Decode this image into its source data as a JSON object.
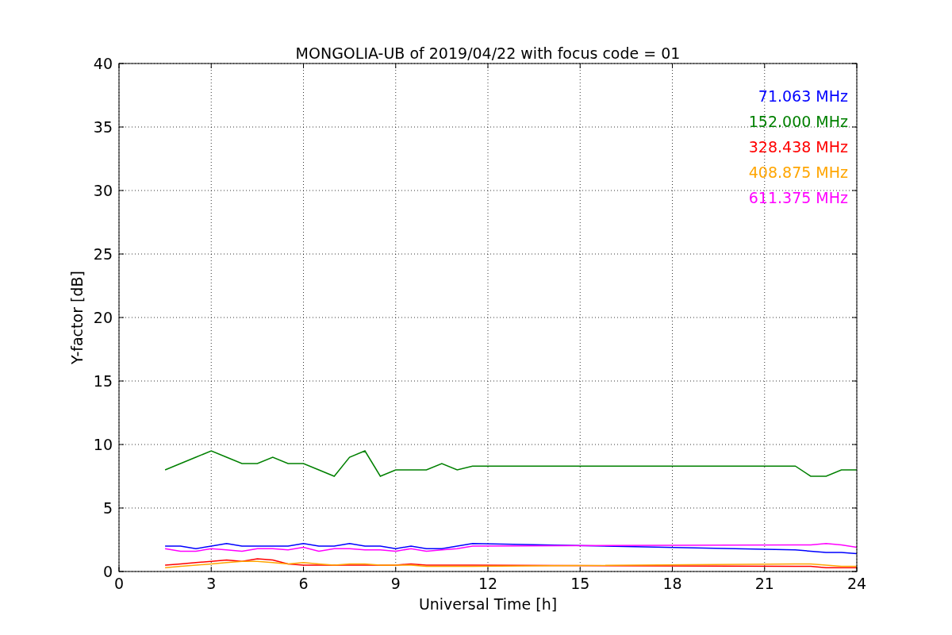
{
  "chart_data": {
    "type": "line",
    "title": "MONGOLIA-UB of 2019/04/22 with focus code = 01",
    "xlabel": "Universal Time [h]",
    "ylabel": "Y-factor [dB]",
    "x": [
      1.5,
      2,
      2.5,
      3,
      3.5,
      4,
      4.5,
      5,
      5.5,
      6,
      6.5,
      7,
      7.5,
      8,
      8.5,
      9,
      9.5,
      10,
      10.5,
      11,
      11.5,
      22,
      22.5,
      23,
      23.5,
      24
    ],
    "series": [
      {
        "name": "71.063 MHz",
        "color": "#0000ff",
        "values": [
          2,
          2,
          1.8,
          2,
          2.2,
          2,
          2,
          2,
          2,
          2.2,
          2,
          2,
          2.2,
          2,
          2,
          1.8,
          2,
          1.8,
          1.8,
          2,
          2.2,
          1.7,
          1.6,
          1.5,
          1.5,
          1.4
        ]
      },
      {
        "name": "152.000 MHz",
        "color": "#008000",
        "values": [
          8,
          8.5,
          9,
          9.5,
          9,
          8.5,
          8.5,
          9,
          8.5,
          8.5,
          8,
          7.5,
          9,
          9.5,
          7.5,
          8,
          8,
          8,
          8.5,
          8,
          8.3,
          8.3,
          7.5,
          7.5,
          8,
          8
        ]
      },
      {
        "name": "328.438 MHz",
        "color": "#ff0000",
        "values": [
          0.5,
          0.6,
          0.7,
          0.8,
          0.9,
          0.8,
          1,
          0.9,
          0.6,
          0.5,
          0.5,
          0.5,
          0.5,
          0.5,
          0.5,
          0.5,
          0.6,
          0.5,
          0.5,
          0.5,
          0.5,
          0.4,
          0.4,
          0.3,
          0.3,
          0.3
        ]
      },
      {
        "name": "408.875 MHz",
        "color": "#ffa500",
        "values": [
          0.3,
          0.4,
          0.5,
          0.6,
          0.7,
          0.8,
          0.8,
          0.7,
          0.6,
          0.7,
          0.6,
          0.5,
          0.6,
          0.6,
          0.5,
          0.5,
          0.5,
          0.4,
          0.4,
          0.4,
          0.4,
          0.6,
          0.6,
          0.5,
          0.4,
          0.4
        ]
      },
      {
        "name": "611.375 MHz",
        "color": "#ff00ff",
        "values": [
          1.8,
          1.6,
          1.6,
          1.8,
          1.7,
          1.6,
          1.8,
          1.8,
          1.7,
          1.9,
          1.6,
          1.8,
          1.8,
          1.7,
          1.7,
          1.6,
          1.8,
          1.6,
          1.7,
          1.8,
          2,
          2.1,
          2.1,
          2.2,
          2.1,
          1.9
        ]
      }
    ],
    "grid": true,
    "xlim": [
      0,
      24
    ],
    "ylim": [
      0,
      40
    ],
    "xticks": [
      0,
      3,
      6,
      9,
      12,
      15,
      18,
      21,
      24
    ],
    "yticks": [
      0,
      5,
      10,
      15,
      20,
      25,
      30,
      35,
      40
    ]
  }
}
